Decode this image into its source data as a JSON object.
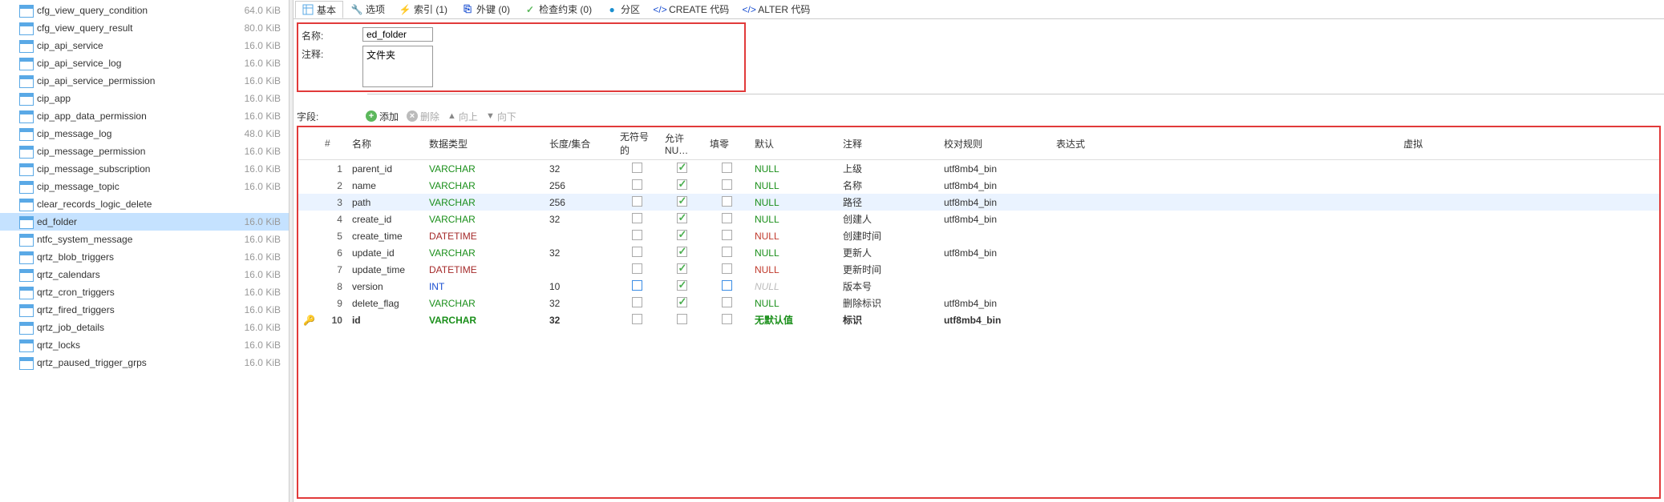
{
  "sidebar": {
    "items": [
      {
        "label": "cfg_view_query_condition",
        "size": "64.0 KiB"
      },
      {
        "label": "cfg_view_query_result",
        "size": "80.0 KiB"
      },
      {
        "label": "cip_api_service",
        "size": "16.0 KiB"
      },
      {
        "label": "cip_api_service_log",
        "size": "16.0 KiB"
      },
      {
        "label": "cip_api_service_permission",
        "size": "16.0 KiB"
      },
      {
        "label": "cip_app",
        "size": "16.0 KiB"
      },
      {
        "label": "cip_app_data_permission",
        "size": "16.0 KiB"
      },
      {
        "label": "cip_message_log",
        "size": "48.0 KiB"
      },
      {
        "label": "cip_message_permission",
        "size": "16.0 KiB"
      },
      {
        "label": "cip_message_subscription",
        "size": "16.0 KiB"
      },
      {
        "label": "cip_message_topic",
        "size": "16.0 KiB"
      },
      {
        "label": "clear_records_logic_delete",
        "size": ""
      },
      {
        "label": "ed_folder",
        "size": "16.0 KiB"
      },
      {
        "label": "ntfc_system_message",
        "size": "16.0 KiB"
      },
      {
        "label": "qrtz_blob_triggers",
        "size": "16.0 KiB"
      },
      {
        "label": "qrtz_calendars",
        "size": "16.0 KiB"
      },
      {
        "label": "qrtz_cron_triggers",
        "size": "16.0 KiB"
      },
      {
        "label": "qrtz_fired_triggers",
        "size": "16.0 KiB"
      },
      {
        "label": "qrtz_job_details",
        "size": "16.0 KiB"
      },
      {
        "label": "qrtz_locks",
        "size": "16.0 KiB"
      },
      {
        "label": "qrtz_paused_trigger_grps",
        "size": "16.0 KiB"
      }
    ],
    "selected_index": 12
  },
  "tabs": [
    {
      "label": "基本",
      "icon": "grid-icon",
      "color": "#5aa9e6"
    },
    {
      "label": "选项",
      "icon": "wrench-icon",
      "color": "#888"
    },
    {
      "label": "索引 (1)",
      "icon": "bolt-icon",
      "color": "#b300b3"
    },
    {
      "label": "外键 (0)",
      "icon": "fk-icon",
      "color": "#1a4fd1"
    },
    {
      "label": "检查约束 (0)",
      "icon": "check-icon",
      "color": "#5cb85c"
    },
    {
      "label": "分区",
      "icon": "circle-icon",
      "color": "#1a8fcf"
    },
    {
      "label": "CREATE 代码",
      "icon": "code-icon",
      "color": "#1a4fd1"
    },
    {
      "label": "ALTER 代码",
      "icon": "code-icon",
      "color": "#1a4fd1"
    }
  ],
  "form": {
    "name_label": "名称:",
    "name_value": "ed_folder",
    "comment_label": "注释:",
    "comment_value": "文件夹"
  },
  "field_toolbar": {
    "section_label": "字段:",
    "add": "添加",
    "remove": "删除",
    "up": "向上",
    "down": "向下"
  },
  "grid": {
    "headers": {
      "num": "#",
      "name": "名称",
      "datatype": "数据类型",
      "length": "长度/集合",
      "unsigned": "无符号的",
      "allow_null": "允许 NU…",
      "zerofill": "填零",
      "default": "默认",
      "comment": "注释",
      "collation": "校对规则",
      "expression": "表达式",
      "virtual": "虚拟"
    },
    "rows": [
      {
        "num": 1,
        "name": "parent_id",
        "datatype": "VARCHAR",
        "dtclass": "vc",
        "length": "32",
        "unsigned": "plain",
        "allow_null": "checked",
        "zerofill": "plain",
        "default": "NULL",
        "defclass": "null-green",
        "comment": "上级",
        "collation": "utf8mb4_bin"
      },
      {
        "num": 2,
        "name": "name",
        "datatype": "VARCHAR",
        "dtclass": "vc",
        "length": "256",
        "unsigned": "plain",
        "allow_null": "checked",
        "zerofill": "plain",
        "default": "NULL",
        "defclass": "null-green",
        "comment": "名称",
        "collation": "utf8mb4_bin"
      },
      {
        "num": 3,
        "name": "path",
        "datatype": "VARCHAR",
        "dtclass": "vc",
        "length": "256",
        "unsigned": "plain",
        "allow_null": "checked",
        "zerofill": "plain",
        "default": "NULL",
        "defclass": "null-green",
        "comment": "路径",
        "collation": "utf8mb4_bin",
        "selected": true
      },
      {
        "num": 4,
        "name": "create_id",
        "datatype": "VARCHAR",
        "dtclass": "vc",
        "length": "32",
        "unsigned": "plain",
        "allow_null": "checked",
        "zerofill": "plain",
        "default": "NULL",
        "defclass": "null-green",
        "comment": "创建人",
        "collation": "utf8mb4_bin"
      },
      {
        "num": 5,
        "name": "create_time",
        "datatype": "DATETIME",
        "dtclass": "dt",
        "length": "",
        "unsigned": "plain",
        "allow_null": "checked",
        "zerofill": "plain",
        "default": "NULL",
        "defclass": "null-red",
        "comment": "创建时间",
        "collation": ""
      },
      {
        "num": 6,
        "name": "update_id",
        "datatype": "VARCHAR",
        "dtclass": "vc",
        "length": "32",
        "unsigned": "plain",
        "allow_null": "checked",
        "zerofill": "plain",
        "default": "NULL",
        "defclass": "null-green",
        "comment": "更新人",
        "collation": "utf8mb4_bin"
      },
      {
        "num": 7,
        "name": "update_time",
        "datatype": "DATETIME",
        "dtclass": "dt",
        "length": "",
        "unsigned": "plain",
        "allow_null": "checked",
        "zerofill": "plain",
        "default": "NULL",
        "defclass": "null-red",
        "comment": "更新时间",
        "collation": ""
      },
      {
        "num": 8,
        "name": "version",
        "datatype": "INT",
        "dtclass": "it",
        "length": "10",
        "unsigned": "blue",
        "allow_null": "checked",
        "zerofill": "blue",
        "default": "NULL",
        "defclass": "null-gray",
        "comment": "版本号",
        "collation": ""
      },
      {
        "num": 9,
        "name": "delete_flag",
        "datatype": "VARCHAR",
        "dtclass": "vc",
        "length": "32",
        "unsigned": "plain",
        "allow_null": "checked",
        "zerofill": "plain",
        "default": "NULL",
        "defclass": "null-green",
        "comment": "删除标识",
        "collation": "utf8mb4_bin"
      },
      {
        "num": 10,
        "name": "id",
        "datatype": "VARCHAR",
        "dtclass": "vc",
        "length": "32",
        "unsigned": "plain",
        "allow_null": "plain",
        "zerofill": "plain",
        "default": "无默认值",
        "defclass": "null-green",
        "comment": "标识",
        "collation": "utf8mb4_bin",
        "bold": true,
        "key": true
      }
    ]
  }
}
